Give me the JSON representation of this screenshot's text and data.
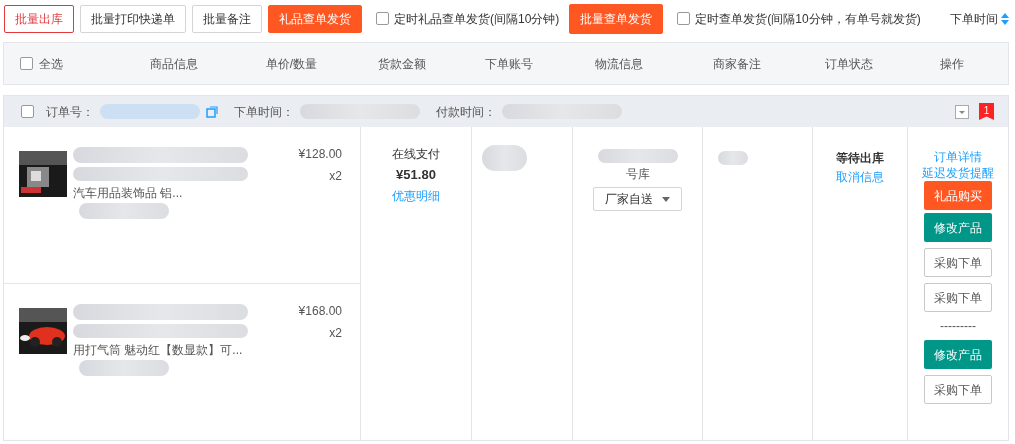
{
  "toolbar": {
    "buttons": [
      {
        "label": "批量出库",
        "kind": "outline-red"
      },
      {
        "label": "批量打印快递单",
        "kind": "outline"
      },
      {
        "label": "批量备注",
        "kind": "outline"
      },
      {
        "label": "礼品查单发货",
        "kind": "primary"
      }
    ],
    "timer_gift": {
      "label": "定时礼品查单发货(间隔10分钟)",
      "checked": false
    },
    "batch_button": {
      "label": "批量查单发货",
      "kind": "primary"
    },
    "timer_all": {
      "label": "定时查单发货(间隔10分钟，有单号就发货)",
      "checked": false
    },
    "sort": {
      "label": "下单时间"
    }
  },
  "table": {
    "select_all": {
      "label": "全选",
      "checked": false
    },
    "columns": [
      "商品信息",
      "单价/数量",
      "货款金额",
      "下单账号",
      "物流信息",
      "商家备注",
      "订单状态",
      "操作"
    ]
  },
  "order": {
    "checked": false,
    "order_no_label": "订单号：",
    "order_time_label": "下单时间：",
    "pay_time_label": "付款时间：",
    "flag": "1",
    "products": [
      {
        "name_visible": "汽车用品装饰品 铝...",
        "price": "¥128.00",
        "qty": "x2"
      },
      {
        "name_visible": "用打气筒 魅动红【数显款】可...",
        "price": "¥168.00",
        "qty": "x2"
      }
    ],
    "payment": {
      "method": "在线支付",
      "amount": "¥51.80",
      "link": "优惠明细"
    },
    "logistics": {
      "text_visible": "号库",
      "dropdown": "厂家自送"
    },
    "status": {
      "text": "等待出库",
      "link": "取消信息"
    },
    "actions": [
      {
        "kind": "link",
        "label": "订单详情"
      },
      {
        "kind": "link",
        "label": "延迟发货提醒"
      },
      {
        "kind": "orange",
        "label": "礼品购买"
      },
      {
        "kind": "green",
        "label": "修改产品"
      },
      {
        "kind": "outline",
        "label": "采购下单"
      },
      {
        "kind": "outline",
        "label": "采购下单"
      },
      {
        "kind": "separator",
        "label": "---------"
      },
      {
        "kind": "green",
        "label": "修改产品"
      },
      {
        "kind": "outline",
        "label": "采购下单"
      }
    ]
  }
}
